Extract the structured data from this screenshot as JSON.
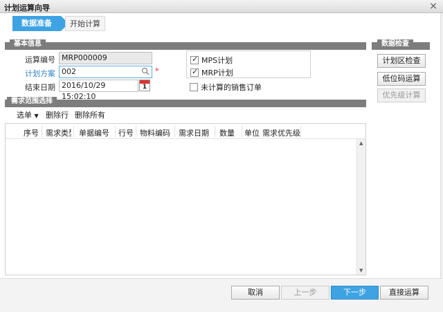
{
  "window": {
    "title": "计划运算向导",
    "close_glyph": "×"
  },
  "steps": [
    {
      "label": "数据准备",
      "active": true
    },
    {
      "label": "开始计算",
      "active": false
    }
  ],
  "basic_info": {
    "header": "基本信息",
    "run_no_label": "运算编号",
    "run_no_value": "MRP000009",
    "plan_scheme_label": "计划方案",
    "plan_scheme_value": "002",
    "required_mark": "*",
    "end_date_label": "结束日期",
    "end_date_value": "2016/10/29 15:02:10",
    "calendar_day": "1"
  },
  "checks": {
    "mps": {
      "label": "MPS计划",
      "checked": true
    },
    "mrp": {
      "label": "MRP计划",
      "checked": true
    },
    "uncalc_sales": {
      "label": "未计算的销售订单",
      "checked": false
    }
  },
  "data_check": {
    "header": "数据检查",
    "plan_area_check": "计划区检查",
    "low_level_code": "低位码运算",
    "priority_calc": "优先级计算"
  },
  "demand_range": {
    "header": "需求范围选择",
    "toolbar": {
      "select": "选单",
      "delete_row": "删除行",
      "delete_all": "删除所有"
    },
    "columns": [
      "序号",
      "需求类型",
      "单据编号",
      "行号",
      "物料编码",
      "需求日期",
      "数量",
      "单位",
      "需求优先级"
    ]
  },
  "footer": {
    "cancel": "取消",
    "prev": "上一步",
    "next": "下一步",
    "direct_run": "直接运算"
  },
  "colors": {
    "accent": "#3ea3e3",
    "section": "#7d7d7d",
    "required": "#dd2222"
  }
}
